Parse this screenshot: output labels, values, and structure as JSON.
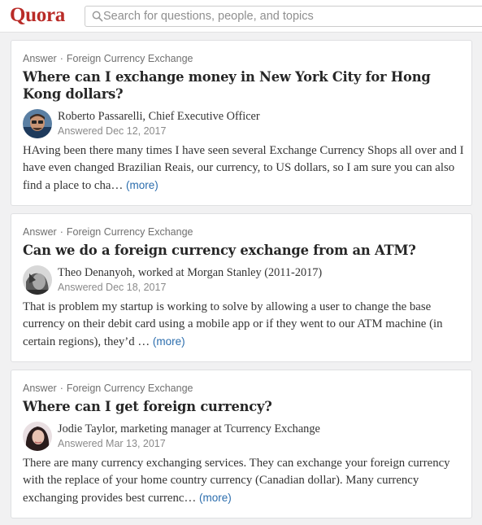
{
  "header": {
    "logo": "Quora",
    "search_placeholder": "Search for questions, people, and topics"
  },
  "feed": [
    {
      "type": "Answer",
      "topic": "Foreign Currency Exchange",
      "question": "Where can I exchange money in New York City for Hong Kong dollars?",
      "author": "Roberto Passarelli, Chief Executive Officer",
      "date": "Answered Dec 12, 2017",
      "excerpt": "HAving been there many times I have seen several Exchange Currency Shops all over and I have even changed Brazilian Reais, our currency, to US dollars, so I am sure you can also find a place to cha…",
      "more": "(more)"
    },
    {
      "type": "Answer",
      "topic": "Foreign Currency Exchange",
      "question": "Can we do a foreign currency exchange from an ATM?",
      "author": "Theo Denanyoh, worked at Morgan Stanley (2011-2017)",
      "date": "Answered Dec 18, 2017",
      "excerpt": "That is problem my startup is working to solve by allowing a user to change the base currency on their debit card using a mobile app or if they went to our ATM machine (in certain regions), they’d …",
      "more": "(more)"
    },
    {
      "type": "Answer",
      "topic": "Foreign Currency Exchange",
      "question": "Where can I get foreign currency?",
      "author": "Jodie Taylor, marketing manager at Tcurrency Exchange",
      "date": "Answered Mar 13, 2017",
      "excerpt": "There are many currency exchanging services. They can exchange your foreign currency with the replace of your home country currency (Canadian dollar). Many currency exchanging provides best currenc…",
      "more": "(more)"
    }
  ]
}
